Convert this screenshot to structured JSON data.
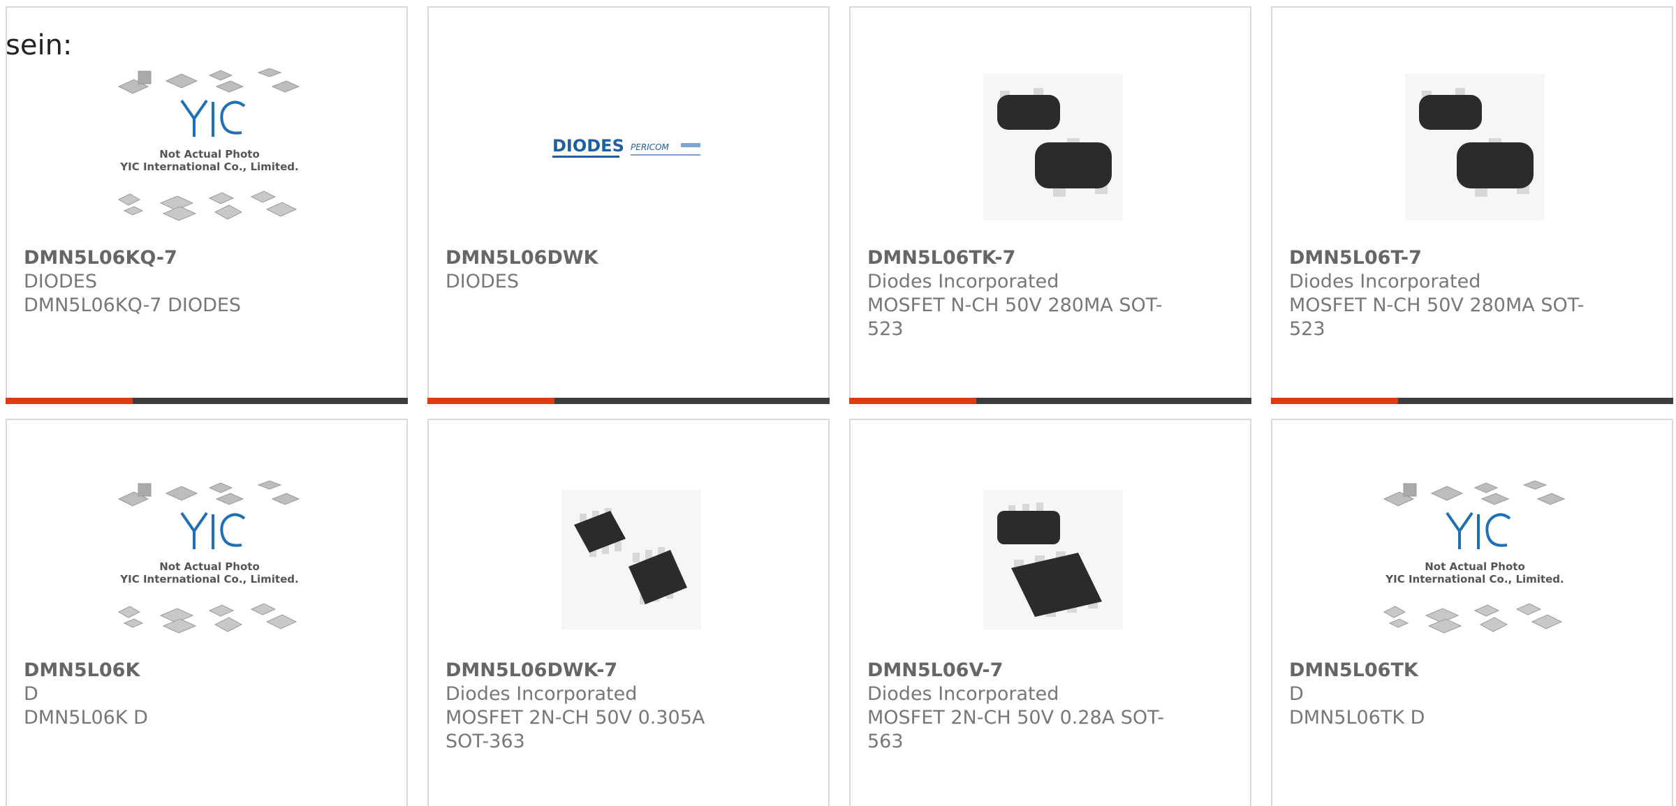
{
  "intro_text": "sein:",
  "colors": {
    "accent": "#e03a13",
    "bar": "#3d3d3d",
    "border": "#d9d9d9",
    "brand_blue": "#1f6fb5"
  },
  "placeholder": {
    "line1": "Not Actual Photo",
    "line2": "YIC International Co., Limited.",
    "logo": "YIC"
  },
  "diodes_logo": {
    "brand": "DIODES",
    "sub": "PERICOM"
  },
  "products": [
    {
      "mpn": "DMN5L06KQ-7",
      "manufacturer": "DIODES",
      "description": "DMN5L06KQ-7 DIODES",
      "image": "placeholder-photo"
    },
    {
      "mpn": "DMN5L06DWK",
      "manufacturer": "DIODES",
      "description": "",
      "image": "diodes-logo"
    },
    {
      "mpn": "DMN5L06TK-7",
      "manufacturer": "Diodes Incorporated",
      "description": "MOSFET N-CH 50V 280MA SOT-523",
      "image": "sot-523-photo"
    },
    {
      "mpn": "DMN5L06T-7",
      "manufacturer": "Diodes Incorporated",
      "description": "MOSFET N-CH 50V 280MA SOT-523",
      "image": "sot-523-photo"
    },
    {
      "mpn": "DMN5L06K",
      "manufacturer": "D",
      "description": "DMN5L06K D",
      "image": "placeholder-photo"
    },
    {
      "mpn": "DMN5L06DWK-7",
      "manufacturer": "Diodes Incorporated",
      "description": "MOSFET 2N-CH 50V 0.305A SOT-363",
      "image": "sot-363-photo"
    },
    {
      "mpn": "DMN5L06V-7",
      "manufacturer": "Diodes Incorporated",
      "description": "MOSFET 2N-CH 50V 0.28A SOT-563",
      "image": "sot-563-photo"
    },
    {
      "mpn": "DMN5L06TK",
      "manufacturer": "D",
      "description": "DMN5L06TK D",
      "image": "placeholder-photo"
    }
  ]
}
